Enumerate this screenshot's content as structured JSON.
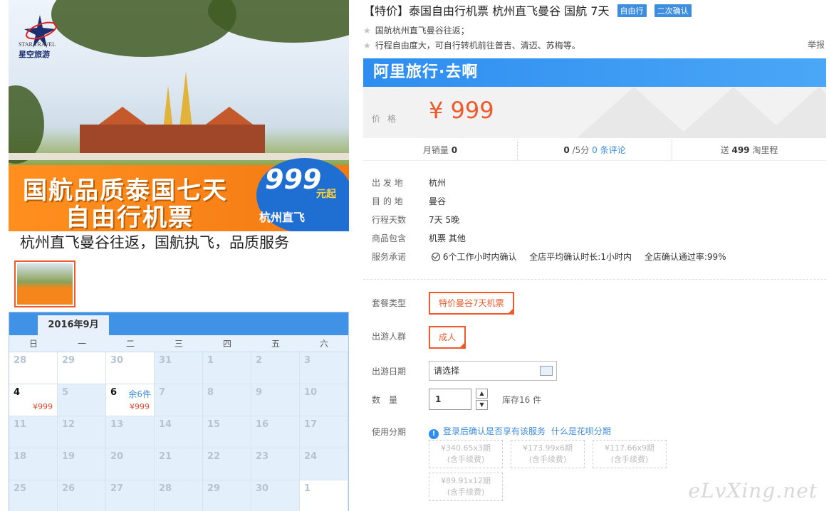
{
  "hero": {
    "logo_en": "STAR TRAVEL",
    "logo_cn": "星空旅游",
    "promo_line1": "国航品质泰国七天",
    "promo_line2": "自由行机票",
    "price_big": "999",
    "price_unit": "元起",
    "route_tag": "杭州直飞"
  },
  "slogan": "杭州直飞曼谷往返，国航执飞，品质服务",
  "calendar": {
    "month": "2016年9月",
    "weekdays": [
      "日",
      "一",
      "二",
      "三",
      "四",
      "五",
      "六"
    ],
    "cells": [
      {
        "d": "28"
      },
      {
        "d": "29"
      },
      {
        "d": "30"
      },
      {
        "d": "31"
      },
      {
        "d": "1"
      },
      {
        "d": "2"
      },
      {
        "d": "3"
      },
      {
        "d": "4",
        "p": "¥999"
      },
      {
        "d": "5"
      },
      {
        "d": "6",
        "s": "余6件",
        "p": "¥999"
      },
      {
        "d": "7"
      },
      {
        "d": "8"
      },
      {
        "d": "9"
      },
      {
        "d": "10"
      },
      {
        "d": "11"
      },
      {
        "d": "12"
      },
      {
        "d": "13"
      },
      {
        "d": "14"
      },
      {
        "d": "15"
      },
      {
        "d": "16"
      },
      {
        "d": "17"
      },
      {
        "d": "18"
      },
      {
        "d": "19"
      },
      {
        "d": "20"
      },
      {
        "d": "21"
      },
      {
        "d": "22"
      },
      {
        "d": "23"
      },
      {
        "d": "24"
      },
      {
        "d": "25"
      },
      {
        "d": "26"
      },
      {
        "d": "27"
      },
      {
        "d": "28"
      },
      {
        "d": "29"
      },
      {
        "d": "30"
      },
      {
        "d": "1"
      }
    ]
  },
  "product": {
    "title": "【特价】泰国自由行机票 杭州直飞曼谷 国航 7天",
    "tag1": "自由行",
    "tag2": "二次确认",
    "feature1": "国航杭州直飞曼谷往返；",
    "feature2": "行程自由度大，可自行转机前往普吉、清迈、苏梅等。",
    "report": "举报",
    "brand": "阿里旅行·去啊",
    "price_label": "价格",
    "price": "¥ 999"
  },
  "stats": {
    "monthly_label": "月销量",
    "monthly_value": "0",
    "score_value": "0",
    "score_suffix": "/5分",
    "reviews": "0 条评论",
    "points_prefix": "送",
    "points_value": "499",
    "points_suffix": "淘里程"
  },
  "info": {
    "from_label": "出 发 地",
    "from_value": "杭州",
    "to_label": "目 的 地",
    "to_value": "曼谷",
    "days_label": "行程天数",
    "days_value": "7天 5晚",
    "include_label": "商品包含",
    "include_value": "机票  其他",
    "service_label": "服务承诺",
    "service_1": "6个工作小时内确认",
    "service_2": "全店平均确认时长:1小时内",
    "service_3": "全店确认通过率:99%"
  },
  "options": {
    "package_label": "套餐类型",
    "package_value": "特价曼谷7天机票",
    "crowd_label": "出游人群",
    "crowd_value": "成人",
    "date_label": "出游日期",
    "date_value": "请选择",
    "qty_label": "数　量",
    "qty_value": "1",
    "stock": "库存16 件",
    "installment_label": "使用分期",
    "installment_tip": "登录后确认是否享有该服务",
    "installment_link": "什么是花呗分期",
    "installments": [
      {
        "amount": "¥340.65x3期",
        "fee": "(含手续费)"
      },
      {
        "amount": "¥173.99x6期",
        "fee": "(含手续费)"
      },
      {
        "amount": "¥117.66x9期",
        "fee": "(含手续费)"
      },
      {
        "amount": "¥89.91x12期",
        "fee": "(含手续费)"
      }
    ]
  },
  "watermark": "eLvXing.net"
}
